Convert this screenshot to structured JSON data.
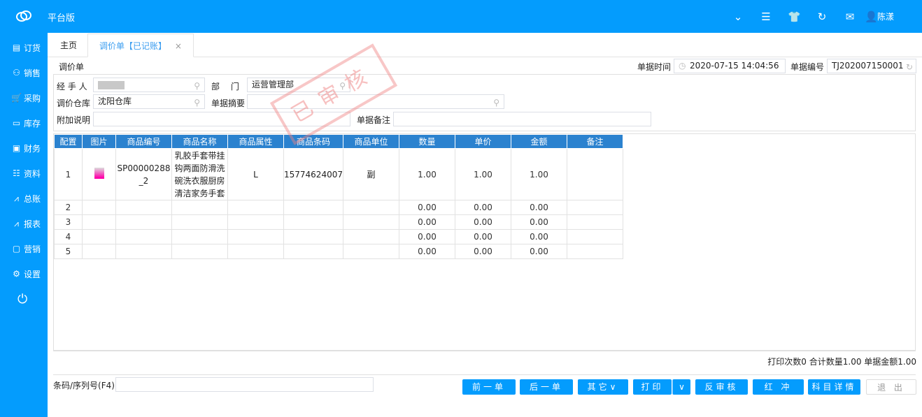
{
  "header": {
    "brand": "平台版",
    "user": "陈漾",
    "icons": [
      "square-chevron-icon",
      "menu-icon",
      "shirt-icon",
      "refresh-icon",
      "mail-icon",
      "user-icon"
    ]
  },
  "sidebar": {
    "items": [
      {
        "label": "订货",
        "icon": "clipboard-icon"
      },
      {
        "label": "销售",
        "icon": "user-icon"
      },
      {
        "label": "采购",
        "icon": "cart-icon"
      },
      {
        "label": "库存",
        "icon": "box-icon"
      },
      {
        "label": "财务",
        "icon": "safe-icon"
      },
      {
        "label": "资料",
        "icon": "contacts-icon"
      },
      {
        "label": "总账",
        "icon": "chart-icon"
      },
      {
        "label": "报表",
        "icon": "chart-icon"
      },
      {
        "label": "营销",
        "icon": "monitor-icon"
      },
      {
        "label": "设置",
        "icon": "gear-icon"
      }
    ]
  },
  "tabs": [
    {
      "label": "主页"
    },
    {
      "label": "调价单【已记账】"
    }
  ],
  "form": {
    "title": "调价单",
    "time_label": "单据时间",
    "time": "2020-07-15 14:04:56",
    "no_label": "单据编号",
    "no": "TJ202007150001",
    "handler_label": "经 手 人",
    "dept_label": "部　 门",
    "dept": "运营管理部",
    "warehouse_label": "调价仓库",
    "warehouse": "沈阳仓库",
    "summary_label": "单据摘要",
    "summary": "",
    "extra_label": "附加说明",
    "extra": "",
    "remark_label": "单据备注",
    "remark": "",
    "stamp": "已审核"
  },
  "table": {
    "columns": [
      "配置",
      "图片",
      "商品编号",
      "商品名称",
      "商品属性",
      "商品条码",
      "商品单位",
      "数量",
      "单价",
      "金额",
      "备注"
    ],
    "rows": [
      [
        "1",
        "",
        "SP00000288_2",
        "乳胶手套带挂钩两面防滑洗碗洗衣服厨房清洁家务手套",
        "L",
        "15774624007",
        "副",
        "1.00",
        "1.00",
        "1.00",
        ""
      ],
      [
        "2",
        "",
        "",
        "",
        "",
        "",
        "",
        "0.00",
        "0.00",
        "0.00",
        ""
      ],
      [
        "3",
        "",
        "",
        "",
        "",
        "",
        "",
        "0.00",
        "0.00",
        "0.00",
        ""
      ],
      [
        "4",
        "",
        "",
        "",
        "",
        "",
        "",
        "0.00",
        "0.00",
        "0.00",
        ""
      ],
      [
        "5",
        "",
        "",
        "",
        "",
        "",
        "",
        "0.00",
        "0.00",
        "0.00",
        ""
      ]
    ]
  },
  "footer": {
    "summary": "打印次数0  合计数量1.00  单据金额1.00",
    "barcode_label": "条码/序列号(F4)",
    "barcode": "",
    "buttons": [
      "前一单",
      "后一单",
      "其它∨",
      "打印",
      "反审核",
      "红 冲",
      "科目详情",
      "退 出"
    ]
  }
}
